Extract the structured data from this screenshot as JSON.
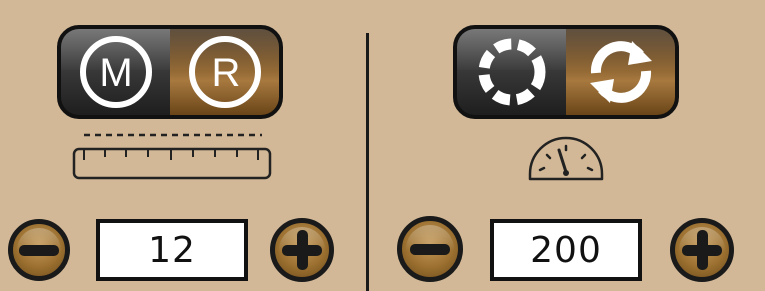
{
  "left": {
    "mode_toggle": {
      "options": [
        "M",
        "R"
      ],
      "selected": "R"
    },
    "length_value": "12"
  },
  "right": {
    "run_toggle": {
      "options": [
        "stopped-icon",
        "cycle-icon"
      ],
      "selected": "cycle-icon"
    },
    "speed_value": "200"
  },
  "colors": {
    "background": "#d2b896",
    "active_segment": "#8a5f2a",
    "inactive_segment": "#3a3a3a",
    "button_fill": "#9b7030",
    "outline": "#111111"
  }
}
